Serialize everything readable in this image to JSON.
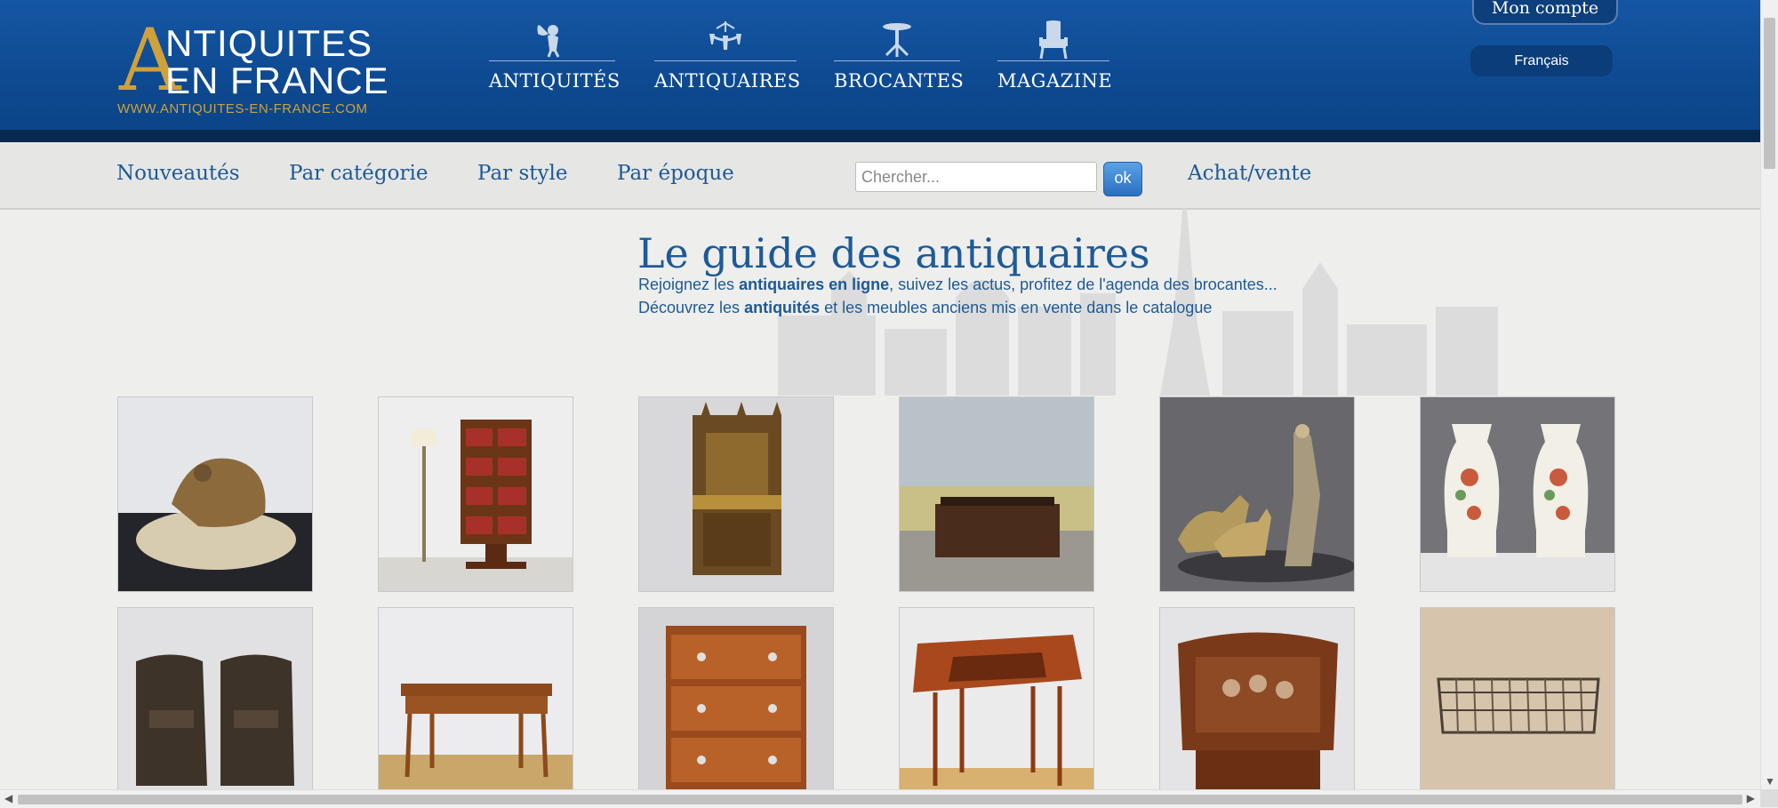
{
  "logo": {
    "big_letter": "A",
    "line1": "NTIQUITES",
    "line2": "EN FRANCE",
    "url": "WWW.ANTIQUITES-EN-FRANCE.COM"
  },
  "header_nav": [
    {
      "label": "ANTIQUITÉS",
      "icon": "cherub-icon"
    },
    {
      "label": "ANTIQUAIRES",
      "icon": "chandelier-icon"
    },
    {
      "label": "BROCANTES",
      "icon": "gueridon-table-icon"
    },
    {
      "label": "MAGAZINE",
      "icon": "armchair-icon"
    }
  ],
  "account": {
    "label": "Mon compte"
  },
  "language": {
    "label": "Français"
  },
  "subnav": [
    {
      "label": "Nouveautés"
    },
    {
      "label": "Par catégorie"
    },
    {
      "label": "Par style"
    },
    {
      "label": "Par époque"
    }
  ],
  "search": {
    "placeholder": "Chercher...",
    "button": "ok"
  },
  "achat_vente": "Achat/vente",
  "hero": {
    "title": "Le guide des antiquaires",
    "line1_pre": "Rejoignez les ",
    "line1_bold": "antiquaires en ligne",
    "line1_post": ", suivez les actus, profitez de l'agenda des brocantes...",
    "line2_pre": "Découvrez les ",
    "line2_bold": "antiquités",
    "line2_post": " et les meubles anciens mis en vente dans le catalogue"
  },
  "products": [
    {
      "name": "bronze-frog-sculpture"
    },
    {
      "name": "revolving-bookcase"
    },
    {
      "name": "gothic-throne-chair"
    },
    {
      "name": "carved-chest"
    },
    {
      "name": "art-deco-lady-greyhounds"
    },
    {
      "name": "canton-vases-pair"
    },
    {
      "name": "leather-club-chairs"
    },
    {
      "name": "louis-xv-writing-table"
    },
    {
      "name": "walnut-chest-of-drawers"
    },
    {
      "name": "marquetry-side-table"
    },
    {
      "name": "inlaid-music-cabinet"
    },
    {
      "name": "brass-wall-shelf"
    }
  ],
  "colors": {
    "header_blue": "#0e4a92",
    "link_blue": "#1d5a97",
    "logo_gold": "#cfa13a"
  }
}
